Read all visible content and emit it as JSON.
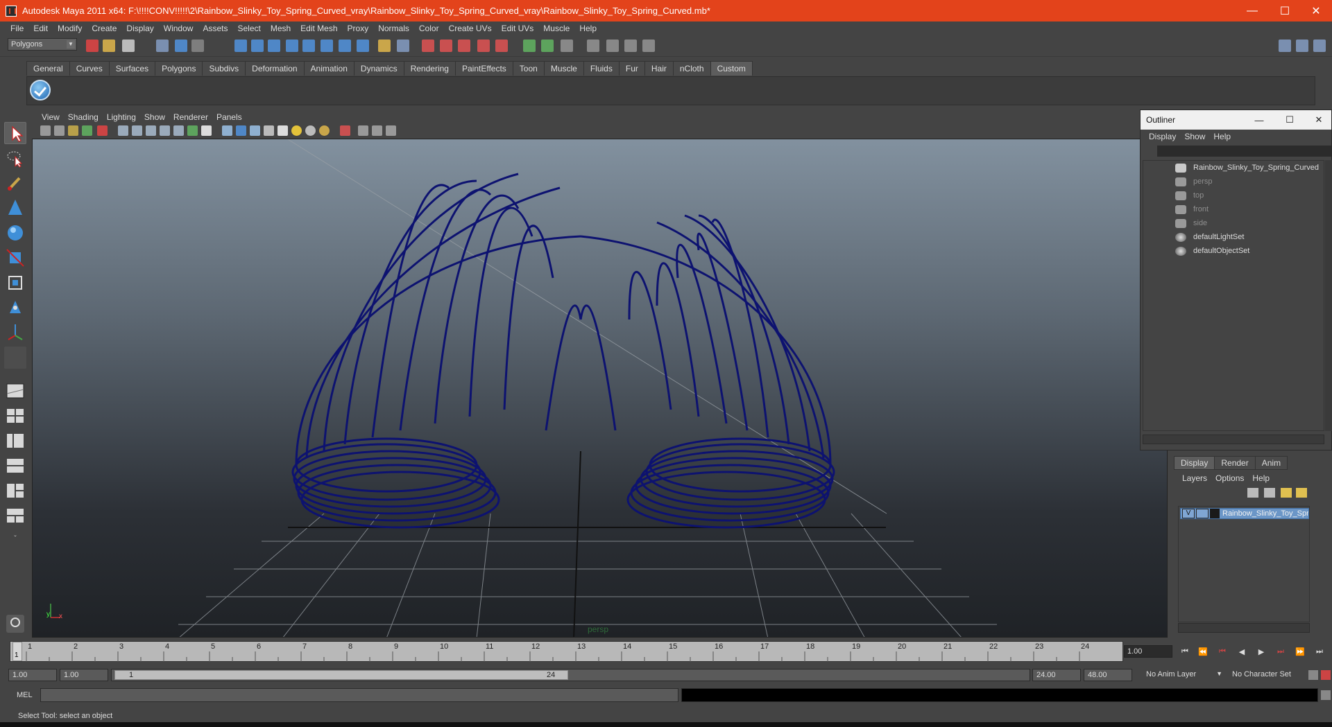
{
  "window": {
    "title": "Autodesk Maya 2011 x64: F:\\!!!!CONV!!!!!\\2\\Rainbow_Slinky_Toy_Spring_Curved_vray\\Rainbow_Slinky_Toy_Spring_Curved_vray\\Rainbow_Slinky_Toy_Spring_Curved.mb*",
    "minimize": "—",
    "maximize": "☐",
    "close": "✕"
  },
  "menu": [
    "File",
    "Edit",
    "Modify",
    "Create",
    "Display",
    "Window",
    "Assets",
    "Select",
    "Mesh",
    "Edit Mesh",
    "Proxy",
    "Normals",
    "Color",
    "Create UVs",
    "Edit UVs",
    "Muscle",
    "Help"
  ],
  "mode_select": {
    "value": "Polygons"
  },
  "shelf": {
    "tabs": [
      "General",
      "Curves",
      "Surfaces",
      "Polygons",
      "Subdivs",
      "Deformation",
      "Animation",
      "Dynamics",
      "Rendering",
      "PaintEffects",
      "Toon",
      "Muscle",
      "Fluids",
      "Fur",
      "Hair",
      "nCloth",
      "Custom"
    ],
    "active": "Custom"
  },
  "viewport": {
    "menu": [
      "View",
      "Shading",
      "Lighting",
      "Show",
      "Renderer",
      "Panels"
    ],
    "camera_label": "persp",
    "axis_y": "y",
    "axis_x": "x"
  },
  "outliner": {
    "title": "Outliner",
    "menu": [
      "Display",
      "Show",
      "Help"
    ],
    "items": [
      {
        "label": "Rainbow_Slinky_Toy_Spring_Curved",
        "dim": false
      },
      {
        "label": "persp",
        "dim": true
      },
      {
        "label": "top",
        "dim": true
      },
      {
        "label": "front",
        "dim": true
      },
      {
        "label": "side",
        "dim": true
      },
      {
        "label": "defaultLightSet",
        "dim": false
      },
      {
        "label": "defaultObjectSet",
        "dim": false
      }
    ]
  },
  "layer_editor": {
    "tabs": [
      "Display",
      "Render",
      "Anim"
    ],
    "active": "Display",
    "menu": [
      "Layers",
      "Options",
      "Help"
    ],
    "layer": {
      "visible": "V",
      "name": "Rainbow_Slinky_Toy_Spri"
    }
  },
  "time_slider": {
    "ticks": [
      "1",
      "2",
      "3",
      "4",
      "5",
      "6",
      "7",
      "8",
      "9",
      "10",
      "11",
      "12",
      "13",
      "14",
      "15",
      "16",
      "17",
      "18",
      "19",
      "20",
      "21",
      "22",
      "23",
      "24"
    ],
    "current_marker": "1",
    "current_frame": "1.00"
  },
  "range": {
    "start": "1.00",
    "playback_start": "1.00",
    "handle_start": "1",
    "handle_end": "24",
    "playback_end": "24.00",
    "end": "48.00",
    "anim_layer": "No Anim Layer",
    "character_set": "No Character Set"
  },
  "command_line": {
    "label": "MEL"
  },
  "help_line": "Select Tool: select an object"
}
